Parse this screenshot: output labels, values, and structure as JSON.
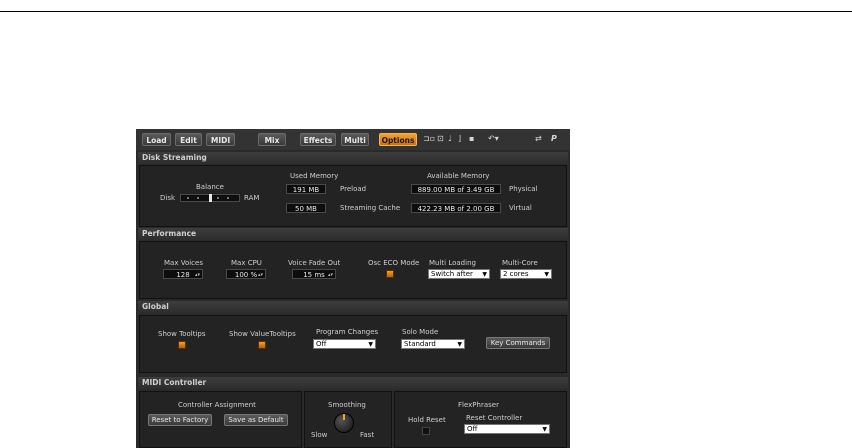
{
  "toolbar": {
    "buttons": [
      "Load",
      "Edit",
      "MIDI",
      "Mix",
      "Effects",
      "Multi",
      "Options"
    ],
    "active": "Options"
  },
  "disk_streaming": {
    "title": "Disk Streaming",
    "balance_label": "Balance",
    "disk_label": "Disk",
    "ram_label": "RAM",
    "balance_value": 0.5,
    "used_memory_label": "Used Memory",
    "available_memory_label": "Available Memory",
    "preload_value": "191 MB",
    "preload_label": "Preload",
    "streaming_cache_value": "50 MB",
    "streaming_cache_label": "Streaming Cache",
    "physical_value": "889.00 MB of 3.49 GB",
    "physical_label": "Physical",
    "virtual_value": "422.23 MB of 2.00 GB",
    "virtual_label": "Virtual"
  },
  "performance": {
    "title": "Performance",
    "max_voices_label": "Max Voices",
    "max_voices_value": "128",
    "max_cpu_label": "Max CPU",
    "max_cpu_value": "100 %",
    "voice_fade_out_label": "Voice Fade Out",
    "voice_fade_out_value": "15 ms",
    "osc_eco_label": "Osc ECO Mode",
    "multi_loading_label": "Multi Loading",
    "multi_loading_value": "Switch after",
    "multi_core_label": "Multi-Core",
    "multi_core_value": "2 cores"
  },
  "global": {
    "title": "Global",
    "show_tooltips_label": "Show Tooltips",
    "show_value_tooltips_label": "Show ValueTooltips",
    "program_changes_label": "Program Changes",
    "program_changes_value": "Off",
    "solo_mode_label": "Solo Mode",
    "solo_mode_value": "Standard",
    "key_commands_label": "Key Commands"
  },
  "midi_controller": {
    "title": "MIDI Controller",
    "controller_assignment_label": "Controller Assignment",
    "reset_factory_label": "Reset to Factory",
    "save_default_label": "Save as Default",
    "smoothing_label": "Smoothing",
    "slow_label": "Slow",
    "fast_label": "Fast",
    "flexphraser_label": "FlexPhraser",
    "hold_reset_label": "Hold Reset",
    "reset_controller_label": "Reset Controller",
    "reset_controller_value": "Off"
  },
  "colors": {
    "accent": "#f0a030",
    "panel_bg": "#2a2a2a"
  }
}
